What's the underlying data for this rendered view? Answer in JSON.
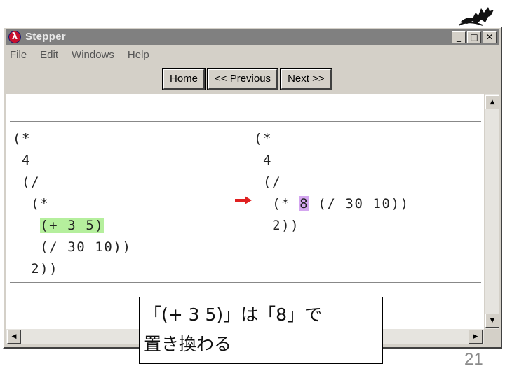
{
  "window": {
    "title": "Stepper",
    "app_icon_glyph": "λ",
    "controls": {
      "minimize": "_",
      "maximize": "□",
      "close": "✕"
    }
  },
  "menu": {
    "items": [
      {
        "label": "File"
      },
      {
        "label": "Edit"
      },
      {
        "label": "Windows"
      },
      {
        "label": "Help"
      }
    ]
  },
  "nav": {
    "home": "Home",
    "previous": "<< Previous",
    "next": "Next >>"
  },
  "before_expr": {
    "lines": [
      "(*",
      " 4",
      " (/",
      "  (*"
    ],
    "highlighted": "(+ 3 5)",
    "highlight_indent": "   ",
    "after_lines": [
      "   (/ 30 10))",
      "  2))"
    ],
    "highlight_color": "#b5ef9d"
  },
  "after_expr": {
    "lines": [
      "(*",
      " 4",
      " (/"
    ],
    "row4_prefix": "  (* ",
    "highlighted": "8",
    "row4_suffix": " (/ 30 10))",
    "after_lines": [
      "  2))"
    ],
    "highlight_color": "#d4a6f0"
  },
  "arrow": {
    "icon": "red-right-arrow-icon",
    "color": "#e02020"
  },
  "caption": {
    "line1": "「(+ 3 5)」は「8」で",
    "line2": "置き換わる"
  },
  "slide": {
    "page_number": "21"
  },
  "icons": {
    "logo": "dragon-logo-icon",
    "scroll_up": "▲",
    "scroll_down": "▼",
    "scroll_left": "◀",
    "scroll_right": "▶"
  }
}
